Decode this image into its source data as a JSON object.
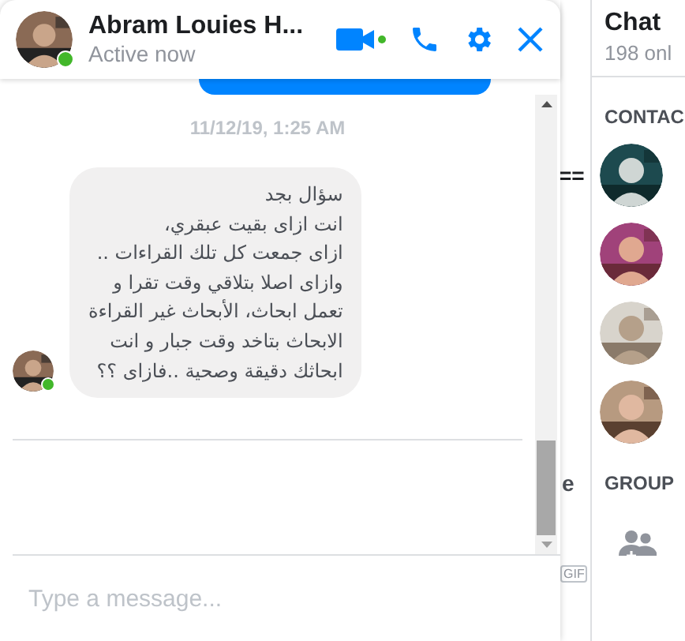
{
  "chat_window": {
    "contact_name": "Abram Louies H...",
    "status": "Active now",
    "online": true,
    "timestamp": "11/12/19, 1:25 AM",
    "messages": [
      {
        "text": "سؤال بجد\nانت ازاى بقيت عبقري،\nازاى جمعت كل تلك القراءات ..\nوازاى اصلا بتلاقي وقت تقرا و\nتعمل ابحاث، الأبحاث غير القراءة\nالابحاث بتاخد وقت جبار و انت\nابحاثك دقيقة وصحية ..فازاى ؟؟",
        "sender_online": true
      }
    ],
    "input": {
      "placeholder": "Type a message..."
    }
  },
  "background_page": {
    "texts": [
      {
        "text": "=="
      },
      {
        "text": "e"
      },
      {
        "text": "GIF"
      }
    ]
  },
  "sidebar": {
    "title": "Chat",
    "online_count": "198 onl",
    "contacts_heading": "CONTAC",
    "groups_heading": "GROUP"
  }
}
